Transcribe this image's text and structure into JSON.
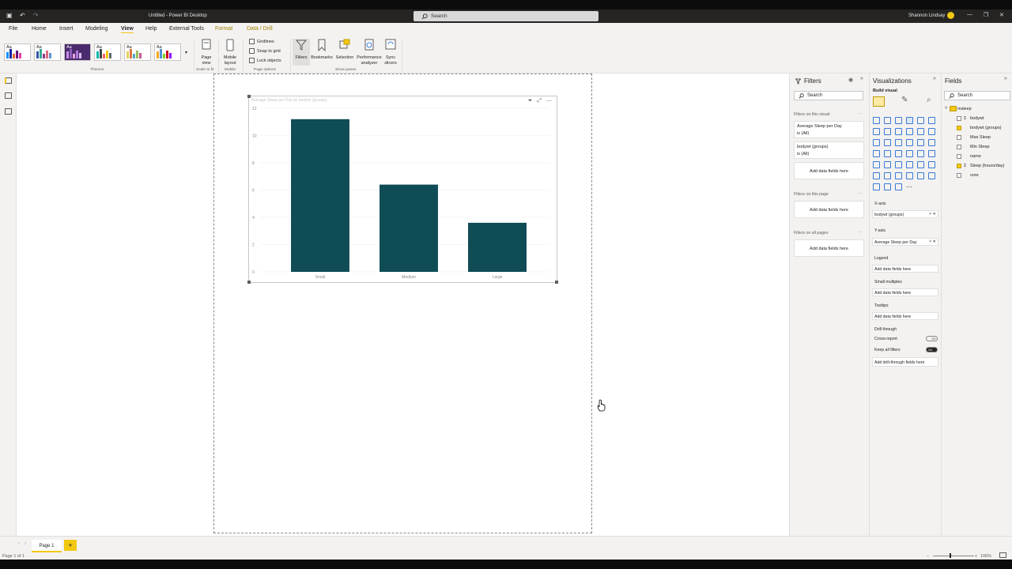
{
  "titlebar": {
    "title": "Untitled - Power BI Desktop",
    "search_placeholder": "Search",
    "user": "Shannon Lindsay"
  },
  "menu": {
    "tabs": [
      "File",
      "Home",
      "Insert",
      "Modeling",
      "View",
      "Help",
      "External Tools",
      "Format",
      "Data / Drill"
    ],
    "active": "View"
  },
  "ribbon": {
    "themes_label": "Themes",
    "scale_label": "Scale to fit",
    "mobile_group": "Mobile",
    "page_options": "Page options",
    "show_panes": "Show panes",
    "page_view": "Page view",
    "mobile_layout": "Mobile layout",
    "gridlines": "Gridlines",
    "snap": "Snap to grid",
    "lock": "Lock objects",
    "filters": "Filters",
    "bookmarks": "Bookmarks",
    "selection": "Selection",
    "performance": "Performance analyzer",
    "sync": "Sync slicers"
  },
  "visual": {
    "title": "Average Sleep per Day by bodywt (groups)"
  },
  "chart_data": {
    "type": "bar",
    "categories": [
      "Small",
      "Medium",
      "Large"
    ],
    "values": [
      11.2,
      6.4,
      3.6
    ],
    "ylim": [
      0,
      12
    ],
    "yticks": [
      0,
      2,
      4,
      6,
      8,
      10,
      12
    ],
    "grid": true,
    "color": "#0f4c55"
  },
  "filters": {
    "title": "Filters",
    "search": "Search",
    "on_visual": "Filters on this visual",
    "cards": [
      {
        "name": "Average Sleep per Day",
        "state": "is (All)"
      },
      {
        "name": "bodywt (groups)",
        "state": "is (All)"
      }
    ],
    "add": "Add data fields here",
    "on_page": "Filters on this page",
    "on_all": "Filters on all pages"
  },
  "viz": {
    "title": "Visualizations",
    "build": "Build visual",
    "xaxis": "X-axis",
    "xaxis_field": "bodywt (groups)",
    "yaxis": "Y-axis",
    "yaxis_field": "Average Sleep per Day",
    "legend": "Legend",
    "small_multiples": "Small multiples",
    "tooltips": "Tooltips",
    "drill": "Drill through",
    "cross_report": "Cross-report",
    "cross_state": "Off",
    "keep_filters": "Keep all filters",
    "keep_state": "On",
    "add": "Add data fields here",
    "add_drill": "Add drill-through fields here"
  },
  "fields": {
    "title": "Fields",
    "search": "Search",
    "table": "msleep",
    "items": [
      {
        "name": "bodywt",
        "sigma": "Σ",
        "checked": false
      },
      {
        "name": "bodywt (groups)",
        "sigma": "",
        "checked": true
      },
      {
        "name": "Max Sleep",
        "sigma": "",
        "checked": false
      },
      {
        "name": "Min Sleep",
        "sigma": "",
        "checked": false
      },
      {
        "name": "name",
        "sigma": "",
        "checked": false
      },
      {
        "name": "Sleep (hours/day)",
        "sigma": "Σ",
        "checked": true
      },
      {
        "name": "vore",
        "sigma": "",
        "checked": false
      }
    ]
  },
  "status": {
    "page_tab": "Page 1",
    "add": "+",
    "page_count": "Page 1 of 1",
    "zoom": "106%"
  }
}
